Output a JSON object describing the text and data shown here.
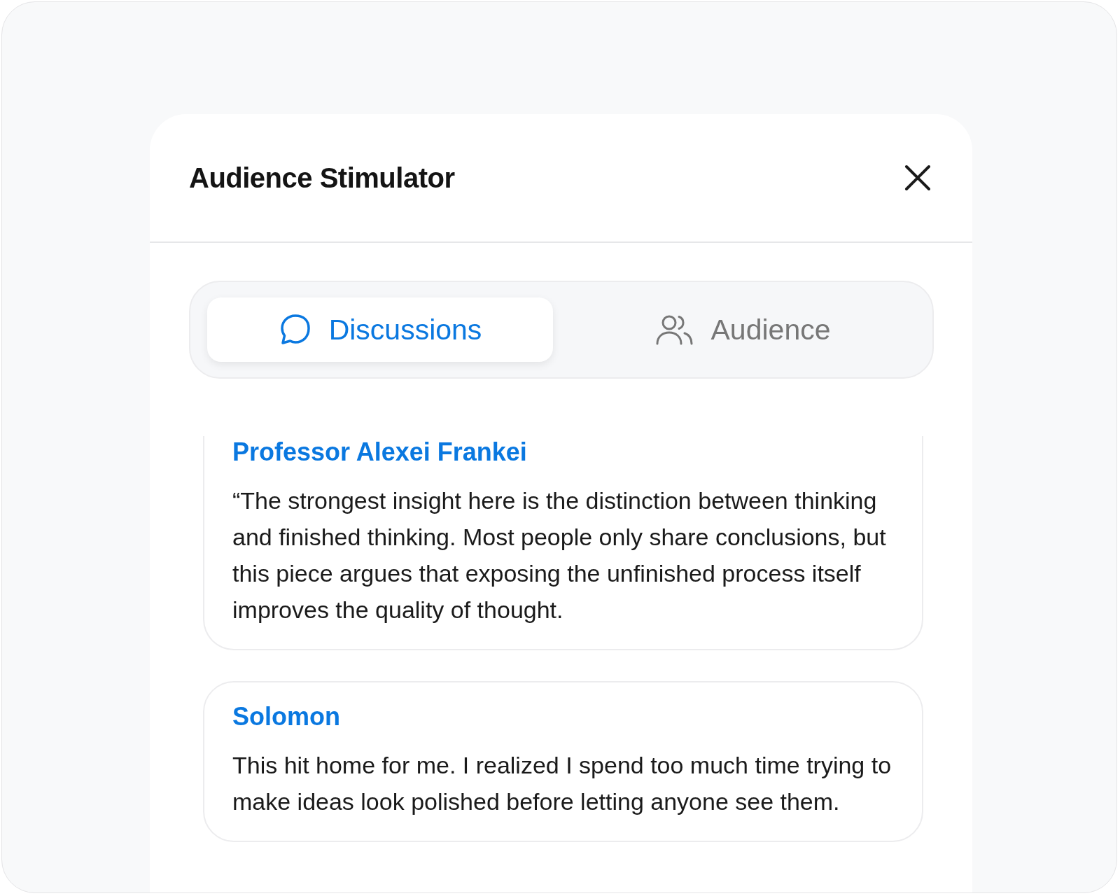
{
  "window": {
    "title": "Audience Stimulator"
  },
  "tabs": [
    {
      "label": "Discussions",
      "kind": "chat",
      "selected": true
    },
    {
      "label": "Audience",
      "kind": "people",
      "selected": false
    }
  ],
  "comments": [
    {
      "author": "Professor Alexei Frankei",
      "text": "“The strongest insight here is the distinction between thinking and finished thinking. Most people only share conclusions, but this piece argues that exposing the unfinished process itself improves the quality of thought."
    },
    {
      "author": "Solomon",
      "text": "This hit home for me. I realized I spend too much time trying to make ideas look polished before letting anyone see them."
    }
  ]
}
